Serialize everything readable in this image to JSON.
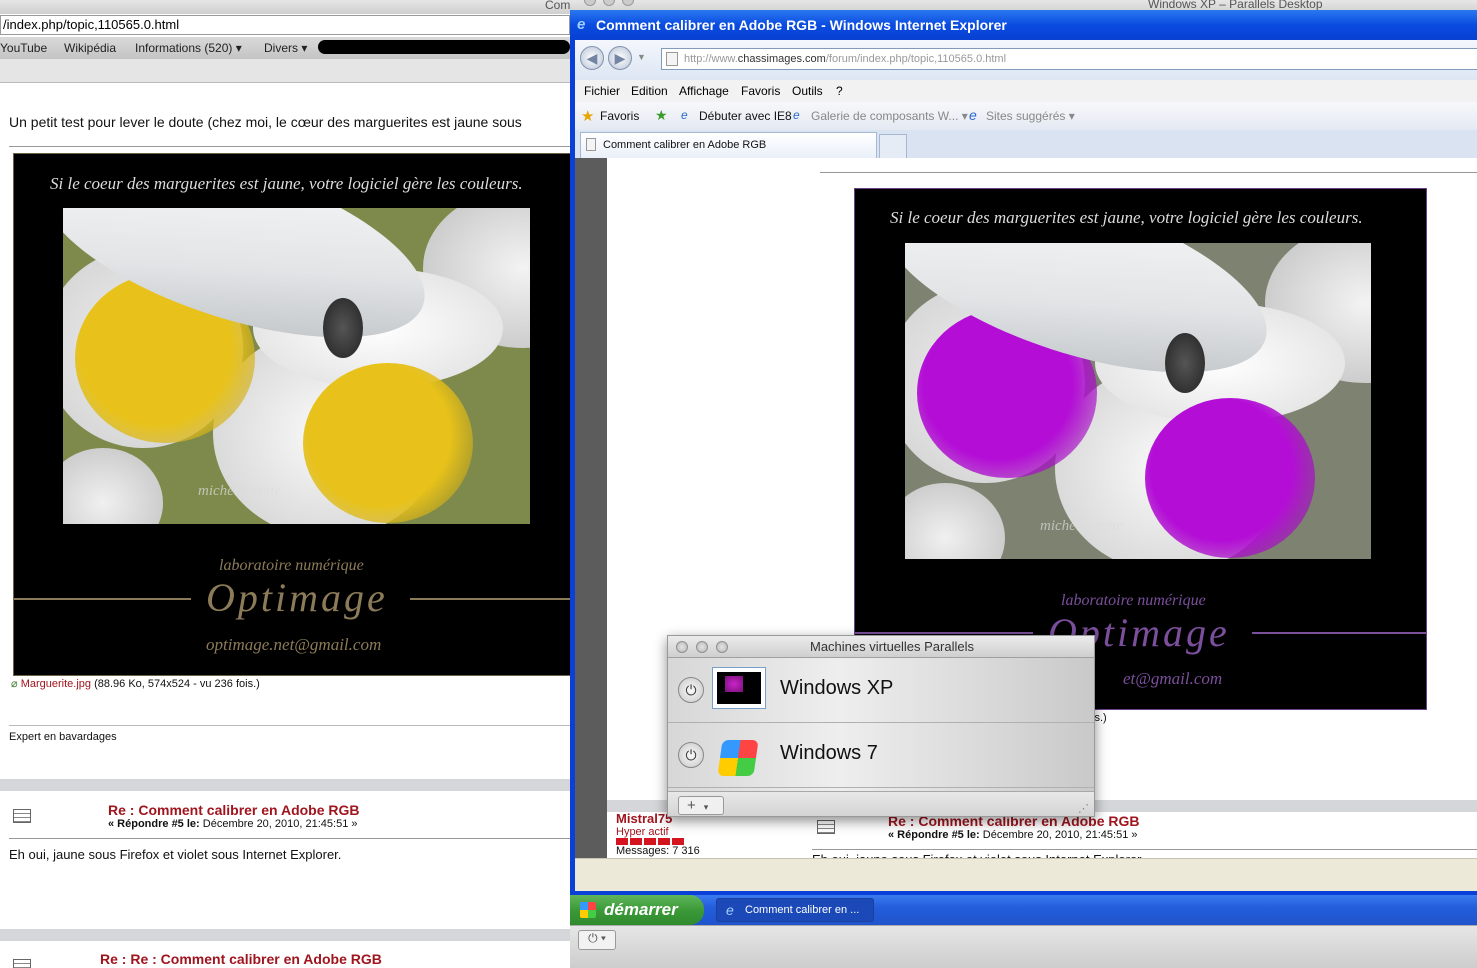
{
  "mac": {
    "center_title": "Com",
    "right_title": "Windows XP – Parallels Desktop"
  },
  "firefox": {
    "url": "/index.php/topic,110565.0.html",
    "bookmarks": [
      "YouTube",
      "Wikipédia",
      "Informations (520) ▾",
      "Divers ▾"
    ],
    "intro": "Un petit test pour lever le doute (chez moi, le cœur des marguerites est jaune sous",
    "image": {
      "caption": "Si le coeur des marguerites est jaune, votre logiciel gère les couleurs.",
      "watermark": "michel pirotte",
      "lab": "laboratoire numérique",
      "brand": "Optimage",
      "email": "optimage.net@gmail.com",
      "center_color": "#e8c21a",
      "accent": "#8c7b58"
    },
    "attachment": {
      "name": "Marguerite.jpg",
      "info": "(88.96 Ko, 574x524 - vu 236 fois.)"
    },
    "signature": "Expert en bavardages",
    "post5": {
      "title": "Re : Comment calibrer en Adobe RGB",
      "meta_prefix": "« Répondre #5 le:",
      "meta_date": "Décembre 20, 2010, 21:45:51 »",
      "body": "Eh oui, jaune sous Firefox et violet sous Internet Explorer."
    },
    "post6": {
      "title": "Re : Re : Comment calibrer en Adobe RGB"
    }
  },
  "ie": {
    "title": "Comment calibrer en Adobe RGB - Windows Internet Explorer",
    "address_prefix": "http://www.",
    "address_domain": "chassimages.com",
    "address_path": "/forum/index.php/topic,110565.0.html",
    "menu": [
      "Fichier",
      "Edition",
      "Affichage",
      "Favoris",
      "Outils",
      "?"
    ],
    "favorites_label": "Favoris",
    "fav_links": [
      "Débuter avec IE8",
      "Galerie de composants W... ▾",
      "Sites suggérés ▾"
    ],
    "tab_label": "Comment calibrer en Adobe RGB",
    "image": {
      "caption": "Si le coeur des marguerites est jaune, votre logiciel gère les couleurs.",
      "watermark": "michel pirotte",
      "lab": "laboratoire numérique",
      "brand": "Optimage",
      "email_partial": "et@gmail.com",
      "center_color": "#b40ed6",
      "accent": "#7b4f9c"
    },
    "attach_partial": "is.)",
    "user": {
      "name": "Mistral75",
      "rank": "Hyper actif",
      "messages": "Messages: 7 316"
    },
    "post5": {
      "title": "Re : Comment calibrer en Adobe RGB",
      "meta_prefix": "« Répondre #5 le:",
      "meta_date": "Décembre 20, 2010, 21:45:51 »",
      "body_partial": "Eh oui, jaune sous Firefox et violet sous Internet Explorer."
    }
  },
  "taskbar": {
    "start_label": "démarrer",
    "item_label": "Comment calibrer en ..."
  },
  "parallels": {
    "title": "Machines virtuelles Parallels",
    "vms": [
      {
        "name": "Windows XP"
      },
      {
        "name": "Windows 7"
      }
    ],
    "add_label": "+"
  }
}
